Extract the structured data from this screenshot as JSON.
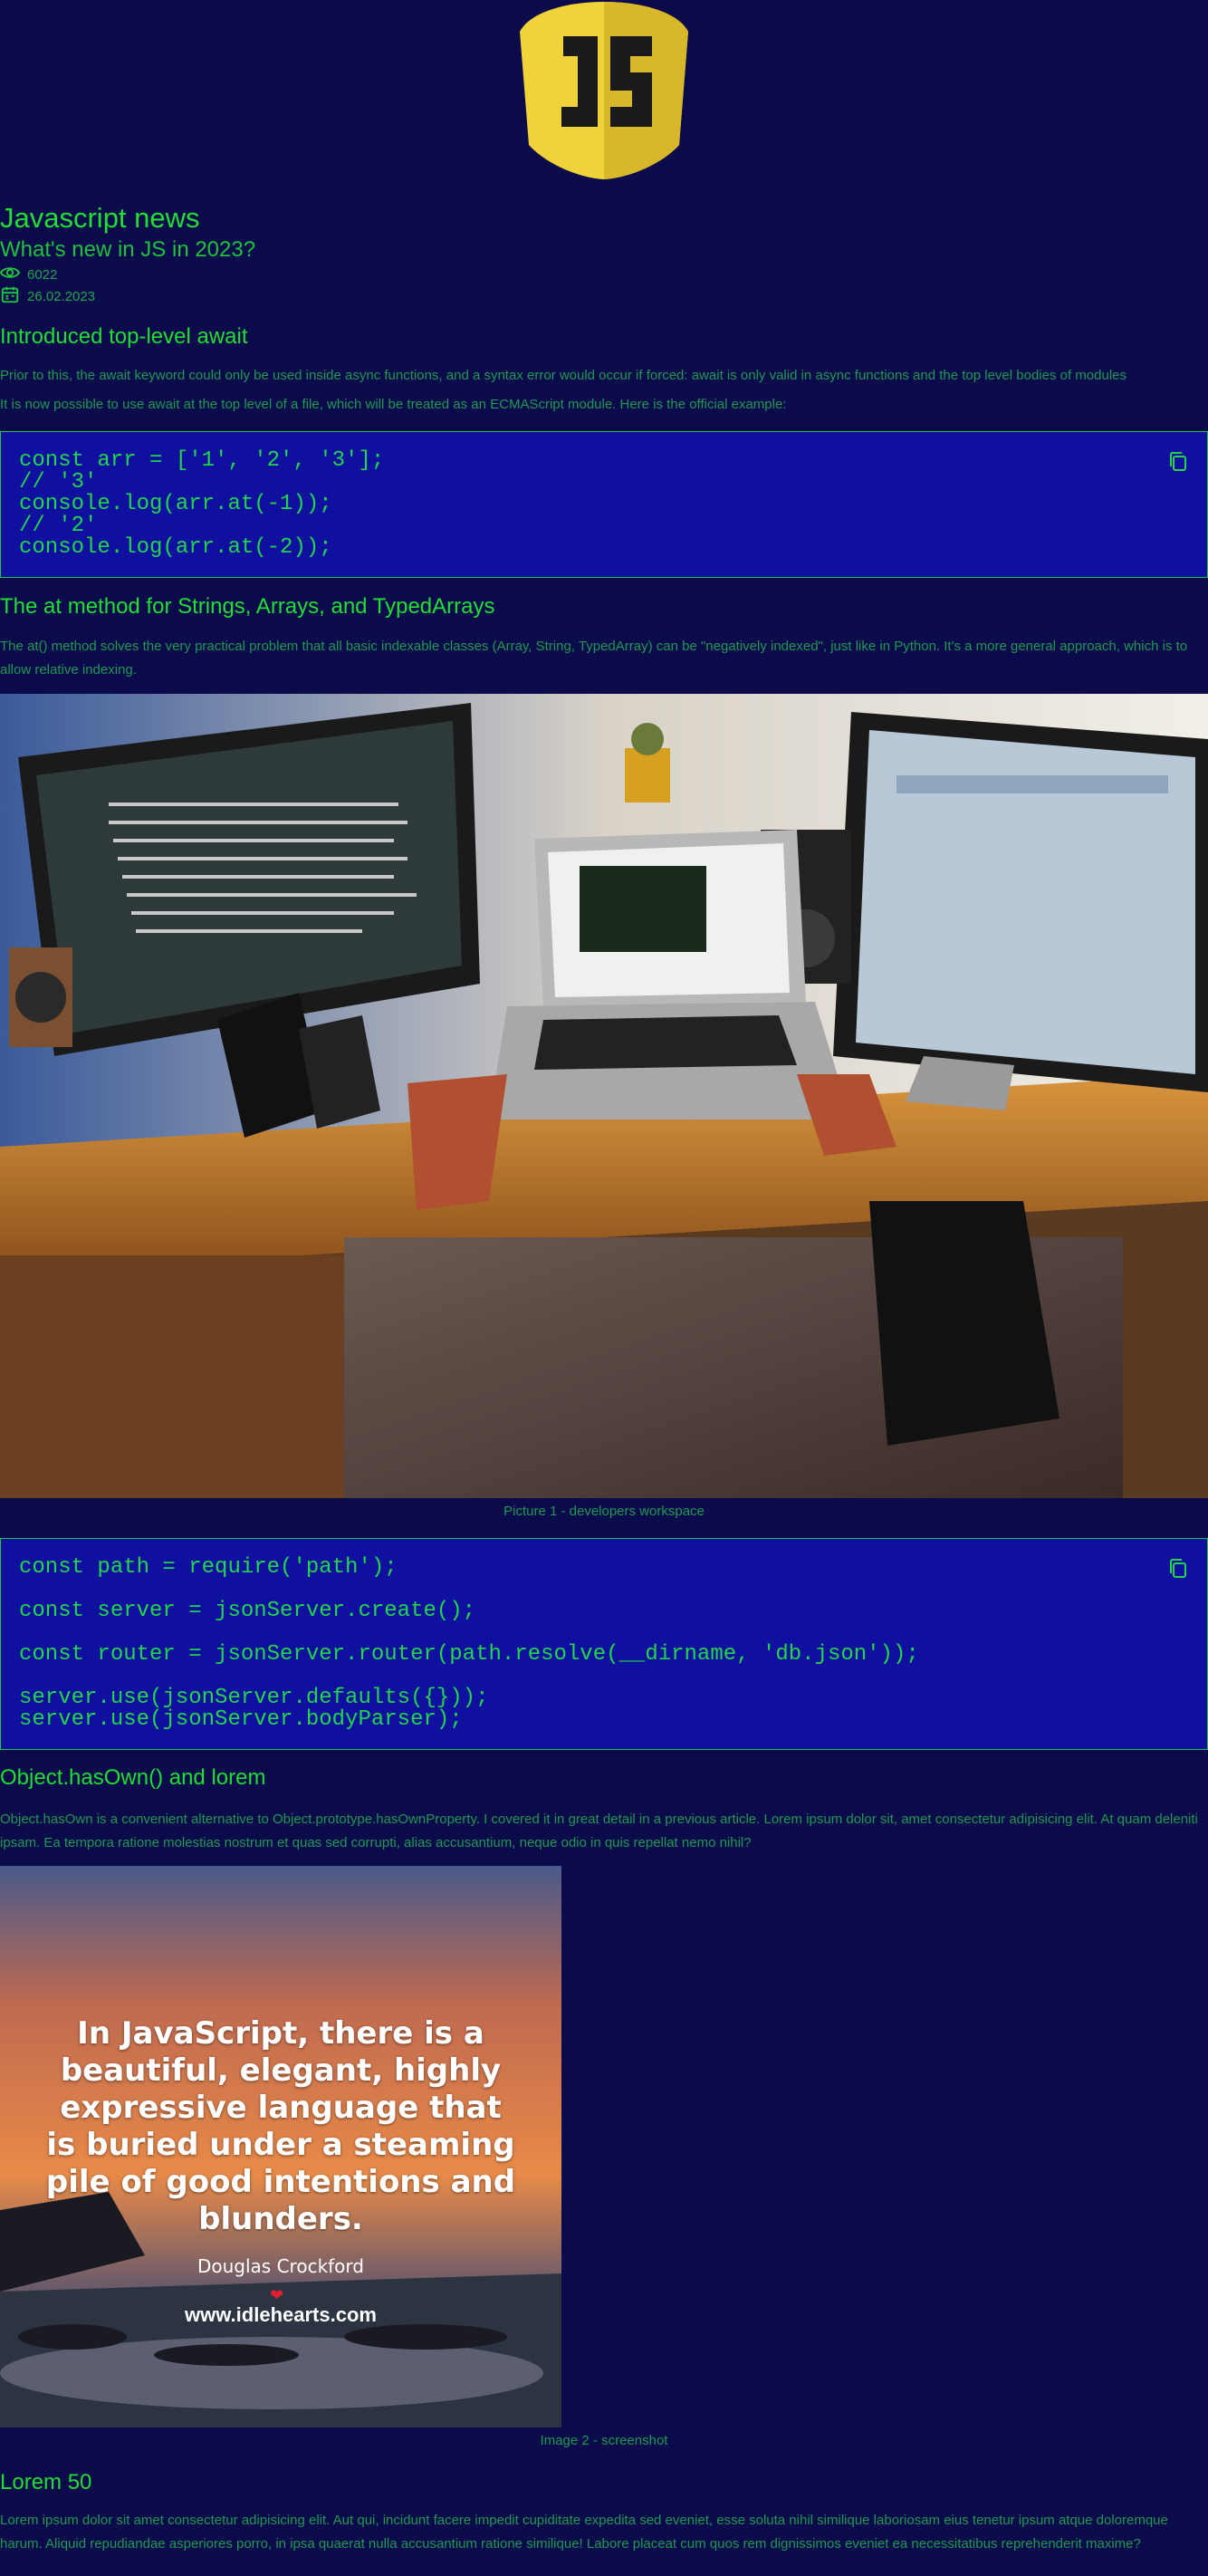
{
  "header": {
    "title": "Javascript news",
    "subtitle": "What's new in JS in 2023?",
    "views": "6022",
    "date": "26.02.2023"
  },
  "sections": [
    {
      "title": "Introduced top-level await",
      "paragraphs": [
        "Prior to this, the await keyword could only be used inside async functions, and a syntax error would occur if forced: await is only valid in async functions and the top level bodies of modules",
        "It is now possible to use await at the top level of a file, which will be treated as an ECMAScript module. Here is the official example:"
      ]
    },
    {
      "title": "The at method for Strings, Arrays, and TypedArrays",
      "paragraphs": [
        "The at() method solves the very practical problem that all basic indexable classes (Array, String, TypedArray) can be \"negatively indexed\", just like in Python. It's a more general approach, which is to allow relative indexing."
      ]
    },
    {
      "title": "Object.hasOwn() and lorem",
      "paragraphs": [
        "Object.hasOwn is a convenient alternative to Object.prototype.hasOwnProperty. I covered it in great detail in a previous article. Lorem ipsum dolor sit, amet consectetur adipisicing elit. At quam deleniti ipsam. Ea tempora ratione molestias nostrum et quas sed corrupti, alias accusantium, neque odio in quis repellat nemo nihil?"
      ]
    },
    {
      "title": "Lorem 50",
      "paragraphs": [
        "Lorem ipsum dolor sit amet consectetur adipisicing elit. Aut qui, incidunt facere impedit cupiditate expedita sed eveniet, esse soluta nihil similique laboriosam eius tenetur ipsum atque doloremque harum. Aliquid repudiandae asperiores porro, in ipsa quaerat nulla accusantium ratione similique! Labore placeat cum quos rem dignissimos eveniet ea necessitatibus reprehenderit maxime?"
      ]
    }
  ],
  "code1": [
    "const arr = ['1', '2', '3'];",
    "// '3'",
    "console.log(arr.at(-1));",
    "// '2'",
    "console.log(arr.at(-2));"
  ],
  "code2": [
    "const path = require('path');",
    "",
    "const server = jsonServer.create();",
    "",
    "const router = jsonServer.router(path.resolve(__dirname, 'db.json'));",
    "",
    "server.use(jsonServer.defaults({}));",
    "server.use(jsonServer.bodyParser);"
  ],
  "figures": {
    "picture1_caption": "Picture 1 - developers workspace",
    "image2_caption": "Image 2 - screenshot",
    "quote_text": "In JavaScript, there is a beautiful, elegant, highly expressive language that is buried under a steaming pile of good intentions and blunders.",
    "quote_author": "Douglas Crockford",
    "quote_site": "www.idlehearts.com"
  },
  "logo": {
    "text": "JS"
  },
  "colors": {
    "background": "#0b0a4a",
    "accent": "#22dd33",
    "code_bg": "#0f0fa0",
    "logo_yellow": "#f0d23a"
  },
  "icons": {
    "views": "eye-icon",
    "date": "calendar-icon",
    "copy": "copy-icon"
  }
}
